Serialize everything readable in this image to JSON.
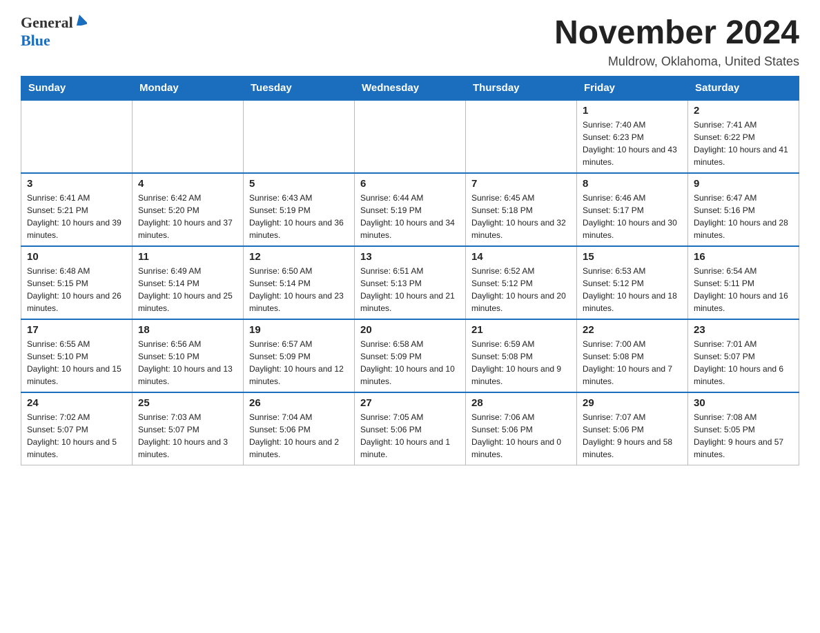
{
  "header": {
    "logo": {
      "general": "General",
      "blue": "Blue"
    },
    "title": "November 2024",
    "location": "Muldrow, Oklahoma, United States"
  },
  "calendar": {
    "days_of_week": [
      "Sunday",
      "Monday",
      "Tuesday",
      "Wednesday",
      "Thursday",
      "Friday",
      "Saturday"
    ],
    "weeks": [
      [
        {
          "day": "",
          "info": ""
        },
        {
          "day": "",
          "info": ""
        },
        {
          "day": "",
          "info": ""
        },
        {
          "day": "",
          "info": ""
        },
        {
          "day": "",
          "info": ""
        },
        {
          "day": "1",
          "info": "Sunrise: 7:40 AM\nSunset: 6:23 PM\nDaylight: 10 hours and 43 minutes."
        },
        {
          "day": "2",
          "info": "Sunrise: 7:41 AM\nSunset: 6:22 PM\nDaylight: 10 hours and 41 minutes."
        }
      ],
      [
        {
          "day": "3",
          "info": "Sunrise: 6:41 AM\nSunset: 5:21 PM\nDaylight: 10 hours and 39 minutes."
        },
        {
          "day": "4",
          "info": "Sunrise: 6:42 AM\nSunset: 5:20 PM\nDaylight: 10 hours and 37 minutes."
        },
        {
          "day": "5",
          "info": "Sunrise: 6:43 AM\nSunset: 5:19 PM\nDaylight: 10 hours and 36 minutes."
        },
        {
          "day": "6",
          "info": "Sunrise: 6:44 AM\nSunset: 5:19 PM\nDaylight: 10 hours and 34 minutes."
        },
        {
          "day": "7",
          "info": "Sunrise: 6:45 AM\nSunset: 5:18 PM\nDaylight: 10 hours and 32 minutes."
        },
        {
          "day": "8",
          "info": "Sunrise: 6:46 AM\nSunset: 5:17 PM\nDaylight: 10 hours and 30 minutes."
        },
        {
          "day": "9",
          "info": "Sunrise: 6:47 AM\nSunset: 5:16 PM\nDaylight: 10 hours and 28 minutes."
        }
      ],
      [
        {
          "day": "10",
          "info": "Sunrise: 6:48 AM\nSunset: 5:15 PM\nDaylight: 10 hours and 26 minutes."
        },
        {
          "day": "11",
          "info": "Sunrise: 6:49 AM\nSunset: 5:14 PM\nDaylight: 10 hours and 25 minutes."
        },
        {
          "day": "12",
          "info": "Sunrise: 6:50 AM\nSunset: 5:14 PM\nDaylight: 10 hours and 23 minutes."
        },
        {
          "day": "13",
          "info": "Sunrise: 6:51 AM\nSunset: 5:13 PM\nDaylight: 10 hours and 21 minutes."
        },
        {
          "day": "14",
          "info": "Sunrise: 6:52 AM\nSunset: 5:12 PM\nDaylight: 10 hours and 20 minutes."
        },
        {
          "day": "15",
          "info": "Sunrise: 6:53 AM\nSunset: 5:12 PM\nDaylight: 10 hours and 18 minutes."
        },
        {
          "day": "16",
          "info": "Sunrise: 6:54 AM\nSunset: 5:11 PM\nDaylight: 10 hours and 16 minutes."
        }
      ],
      [
        {
          "day": "17",
          "info": "Sunrise: 6:55 AM\nSunset: 5:10 PM\nDaylight: 10 hours and 15 minutes."
        },
        {
          "day": "18",
          "info": "Sunrise: 6:56 AM\nSunset: 5:10 PM\nDaylight: 10 hours and 13 minutes."
        },
        {
          "day": "19",
          "info": "Sunrise: 6:57 AM\nSunset: 5:09 PM\nDaylight: 10 hours and 12 minutes."
        },
        {
          "day": "20",
          "info": "Sunrise: 6:58 AM\nSunset: 5:09 PM\nDaylight: 10 hours and 10 minutes."
        },
        {
          "day": "21",
          "info": "Sunrise: 6:59 AM\nSunset: 5:08 PM\nDaylight: 10 hours and 9 minutes."
        },
        {
          "day": "22",
          "info": "Sunrise: 7:00 AM\nSunset: 5:08 PM\nDaylight: 10 hours and 7 minutes."
        },
        {
          "day": "23",
          "info": "Sunrise: 7:01 AM\nSunset: 5:07 PM\nDaylight: 10 hours and 6 minutes."
        }
      ],
      [
        {
          "day": "24",
          "info": "Sunrise: 7:02 AM\nSunset: 5:07 PM\nDaylight: 10 hours and 5 minutes."
        },
        {
          "day": "25",
          "info": "Sunrise: 7:03 AM\nSunset: 5:07 PM\nDaylight: 10 hours and 3 minutes."
        },
        {
          "day": "26",
          "info": "Sunrise: 7:04 AM\nSunset: 5:06 PM\nDaylight: 10 hours and 2 minutes."
        },
        {
          "day": "27",
          "info": "Sunrise: 7:05 AM\nSunset: 5:06 PM\nDaylight: 10 hours and 1 minute."
        },
        {
          "day": "28",
          "info": "Sunrise: 7:06 AM\nSunset: 5:06 PM\nDaylight: 10 hours and 0 minutes."
        },
        {
          "day": "29",
          "info": "Sunrise: 7:07 AM\nSunset: 5:06 PM\nDaylight: 9 hours and 58 minutes."
        },
        {
          "day": "30",
          "info": "Sunrise: 7:08 AM\nSunset: 5:05 PM\nDaylight: 9 hours and 57 minutes."
        }
      ]
    ]
  }
}
